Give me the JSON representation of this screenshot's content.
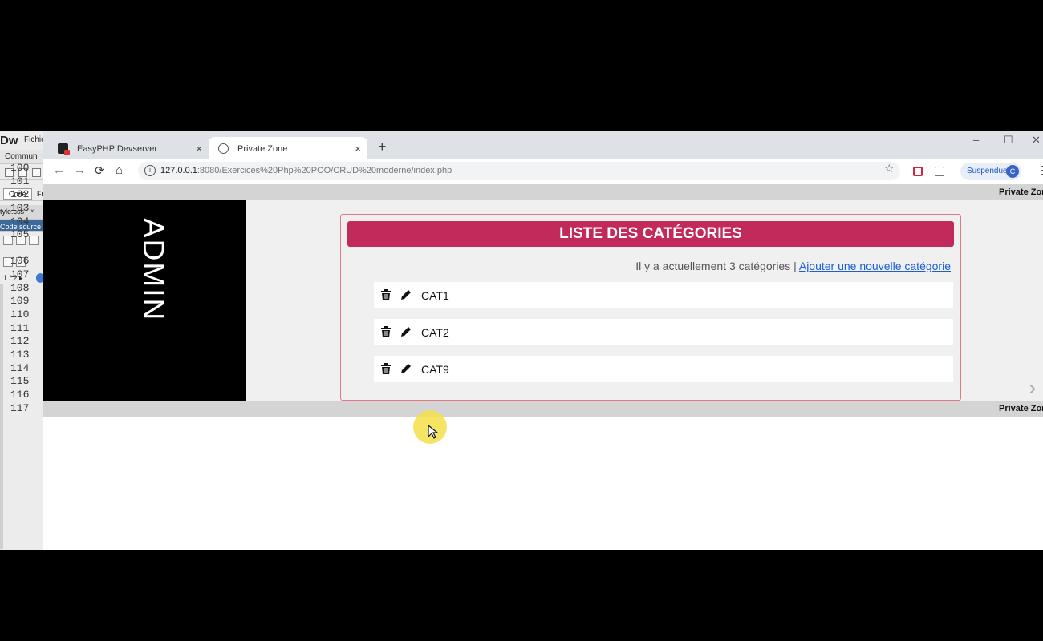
{
  "editor": {
    "logo": "Dw",
    "menu_item": "Fichie",
    "panel_label": "Commun",
    "code_button": "Code",
    "split_button": "Fr",
    "file_tab": "tyle.css",
    "file_close": "×",
    "source_label": "Code source",
    "page_indicator": "1 / 2 ▸",
    "line_numbers": [
      "100",
      "101",
      "102",
      "103",
      "104",
      "105",
      "106",
      "107",
      "108",
      "109",
      "110",
      "111",
      "112",
      "113",
      "114",
      "115",
      "116",
      "117"
    ]
  },
  "browser": {
    "tabs": [
      {
        "title": "EasyPHP Devserver",
        "close": "×"
      },
      {
        "title": "Private Zone",
        "close": "×"
      }
    ],
    "new_tab": "+",
    "window_controls": {
      "minimize": "–",
      "maximize": "☐",
      "close": "✕"
    },
    "nav": {
      "back": "←",
      "forward": "→",
      "reload": "⟳",
      "home": "⌂"
    },
    "url_host": "127.0.0.1",
    "url_rest": ":8080/Exercices%20Php%20POO/CRUD%20moderne/index.php",
    "bookmark": "☆",
    "suspend_label": "Suspendue",
    "avatar_letter": "C",
    "menu": "⋮"
  },
  "page": {
    "zone_title": "Private Zone",
    "footer_title": "Private Zone",
    "sidebar_label": "ADMIN",
    "panel_title": "LISTE DES CATÉGORIES",
    "count_text": "Il y a actuellement 3 catégories | ",
    "add_link": "Ajouter une nouvelle catégorie",
    "categories": [
      {
        "name": "CAT1"
      },
      {
        "name": "CAT2"
      },
      {
        "name": "CAT9"
      }
    ],
    "next_chevron": "›"
  }
}
